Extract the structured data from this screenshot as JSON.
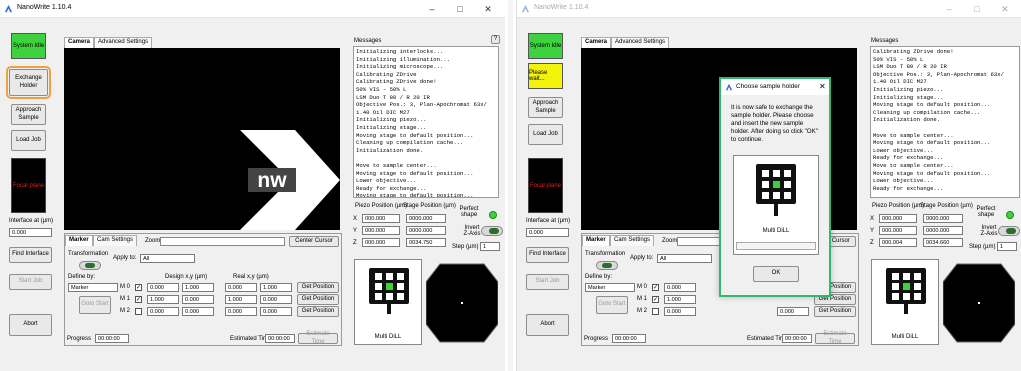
{
  "window": {
    "title": "NanoWrite 1.10.4",
    "controls": {
      "minimize": "–",
      "maximize": "□",
      "close": "✕"
    }
  },
  "colors": {
    "status_idle": "#3fd23f",
    "status_wait": "#f2f20a",
    "highlight": "#f0a03c",
    "dialog_border": "#30b870",
    "marker_green": "#37d437"
  },
  "icons": {
    "app": "nanowrite-icon",
    "dialog": "nanowrite-icon"
  },
  "left": {
    "status": "System Idle",
    "buttons": {
      "exchange": "Exchange Holder",
      "approach": "Approach Sample",
      "load": "Load Job",
      "abort": "Abort",
      "find": "Find Interface",
      "start_job": "Start Job",
      "goto": "Goto Start"
    },
    "preview": "Focal plane",
    "interface_label": "Interface at (µm)",
    "interface_value": "0.000",
    "tabs": [
      "Camera",
      "Advanced Settings"
    ],
    "help": "?",
    "logo": "nw",
    "messages_label": "Messages",
    "messages": "Initializing interlocks...\nInitializing illumination...\nInitializing microscope...\nCalibrating ZDrive\nCalibrating ZDrive done!\n50% VIS - 50% L\nLSM Duo T 80 / R 20 IR\nObjective Pos.: 3, Plan-Apochromat 63x/\n1.40 Oil DIC M27\nInitializing piezo...\nInitializing stage...\nMoving stage to default position...\nCleaning up compilation cache...\nInitialization done.\n\nMove to sample center...\nMoving stage to default position...\nLower objective...\nReady for exchange...\nMoving stage to default position...",
    "subtabs": [
      "Marker",
      "Cam Settings"
    ],
    "zoom_label": "Zoom",
    "center_cursor": "Center Cursor",
    "transformation": "Transformation",
    "apply_to_label": "Apply to:",
    "apply_to": "All",
    "define_by": "Define by:",
    "define_value": "Marker",
    "design_header": "Design x,y (µm)",
    "real_header": "Real x,y (µm)",
    "rows": [
      {
        "label": "M 0",
        "checked": "✓",
        "dx": "0.000",
        "dy": "1.000",
        "rx": "0.000",
        "ry": "1.000",
        "btn": "Get Position"
      },
      {
        "label": "M 1",
        "checked": "✓",
        "dx": "1.000",
        "dy": "0.000",
        "rx": "1.000",
        "ry": "0.000",
        "btn": "Get Position"
      },
      {
        "label": "M 2",
        "checked": "",
        "dx": "0.000",
        "dy": "0.000",
        "rx": "0.000",
        "ry": "0.000",
        "btn": "Get Position"
      }
    ],
    "progress_label": "Progress",
    "progress_value": "00:00:00",
    "est_label": "Estimated Time",
    "est_value": "00:00:00",
    "est_btn": "Estimate Time",
    "piezo_header": "Piezo Position (µm)",
    "stage_header": "Stage Position (µm)",
    "axes": [
      {
        "axis": "X",
        "piezo": "000.000",
        "stage": "0000.000"
      },
      {
        "axis": "Y",
        "piezo": "000.000",
        "stage": "0000.000"
      },
      {
        "axis": "Z",
        "piezo": "000.000",
        "stage": "0034.750"
      }
    ],
    "perfect_shape": "Perfect shape",
    "invert_z": "Invert Z-Axis",
    "step_label": "Step (µm)",
    "step_value": "1",
    "holder_name": "Multi DiLL"
  },
  "right": {
    "status": "Please wait...",
    "messages": "Calibrating ZDrive done!\n50% VIS - 50% L\nLSM Duo T 80 / R 20 IR\nObjective Pos.: 3, Plan-Apochromat 63x/\n1.40 Oil DIC M27\nInitializing piezo...\nInitializing stage...\nMoving stage to default position...\nCleaning up compilation cache...\nInitialization done.\n\nMove to sample center...\nMoving stage to default position...\nLower objective...\nReady for exchange...\nMove to sample center...\nMoving stage to default position...\nLower objective...\nReady for exchange...",
    "axes": [
      {
        "axis": "X",
        "piezo": "000.000",
        "stage": "0000.000"
      },
      {
        "axis": "Y",
        "piezo": "000.000",
        "stage": "0000.000"
      },
      {
        "axis": "Z",
        "piezo": "000.004",
        "stage": "0034.660"
      }
    ],
    "step_label": "Step (µm)",
    "step_value": "1"
  },
  "dialog": {
    "title": "Choose sample holder",
    "close": "✕",
    "message": "It is now safe to exchange the sample holder. Please choose and insert the new sample holder. After doing so click \"OK\" to continue.",
    "holder": "Multi DiLL",
    "ok": "OK"
  }
}
